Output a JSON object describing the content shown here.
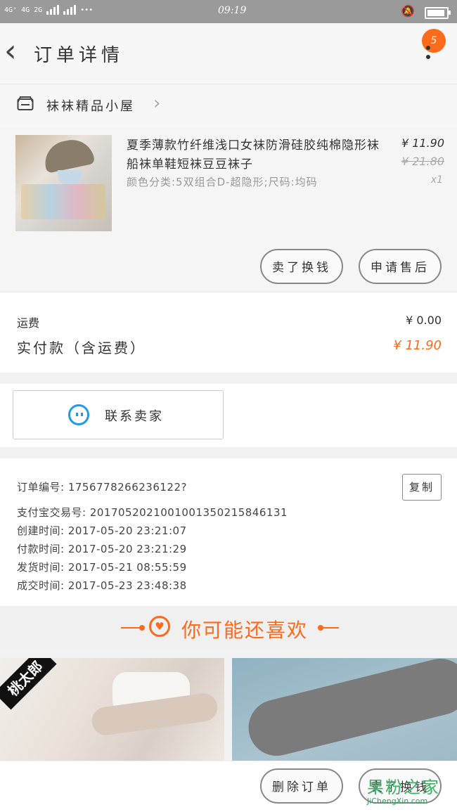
{
  "status": {
    "network": "4G⁺ 4G 2G",
    "time": "09:19",
    "icons": [
      "signal-icon",
      "mute-bell-icon",
      "battery-icon"
    ]
  },
  "header": {
    "back_icon": "chevron-left-icon",
    "title": "订单详情",
    "badge": "5",
    "menu_icon": "more-vertical-icon"
  },
  "shop": {
    "icon": "shop-icon",
    "name": "袜袜精品小屋",
    "arrow": "›"
  },
  "product": {
    "title": "夏季薄款竹纤维浅口女袜防滑硅胶纯棉隐形袜船袜单鞋短袜豆豆袜子",
    "spec": "颜色分类:5双组合D-超隐形;尺码:均码",
    "price": "¥ 11.90",
    "original_price": "¥ 21.80",
    "qty": "x1",
    "btn_sell": "卖了换钱",
    "btn_aftersale": "申请售后"
  },
  "fees": {
    "shipping_label": "运费",
    "shipping_value": "¥ 0.00",
    "paid_label": "实付款（含运费）",
    "paid_value": "¥ 11.90",
    "accent": "#ff6a1a"
  },
  "contact": {
    "icon": "chat-bubble-icon",
    "label": "联系卖家"
  },
  "order_info": {
    "rows": [
      "订单编号: 1756778266236122?",
      "支付宝交易号: 2017052021001001350215846131",
      "创建时间: 2017-05-20 23:21:07",
      "付款时间: 2017-05-20 23:21:29",
      "发货时间: 2017-05-21 08:55:59",
      "成交时间: 2017-05-23 23:48:38"
    ],
    "copy_label": "复制"
  },
  "recommend": {
    "title": "你可能还喜欢",
    "heart_icon": "heart-icon",
    "item1_badge": "桃太郎"
  },
  "bottom": {
    "btn_delete": "删除订单",
    "btn_sell": "卖了换钱",
    "watermark_big": "果粉之家",
    "watermark_small": "JiChengXin.com"
  }
}
